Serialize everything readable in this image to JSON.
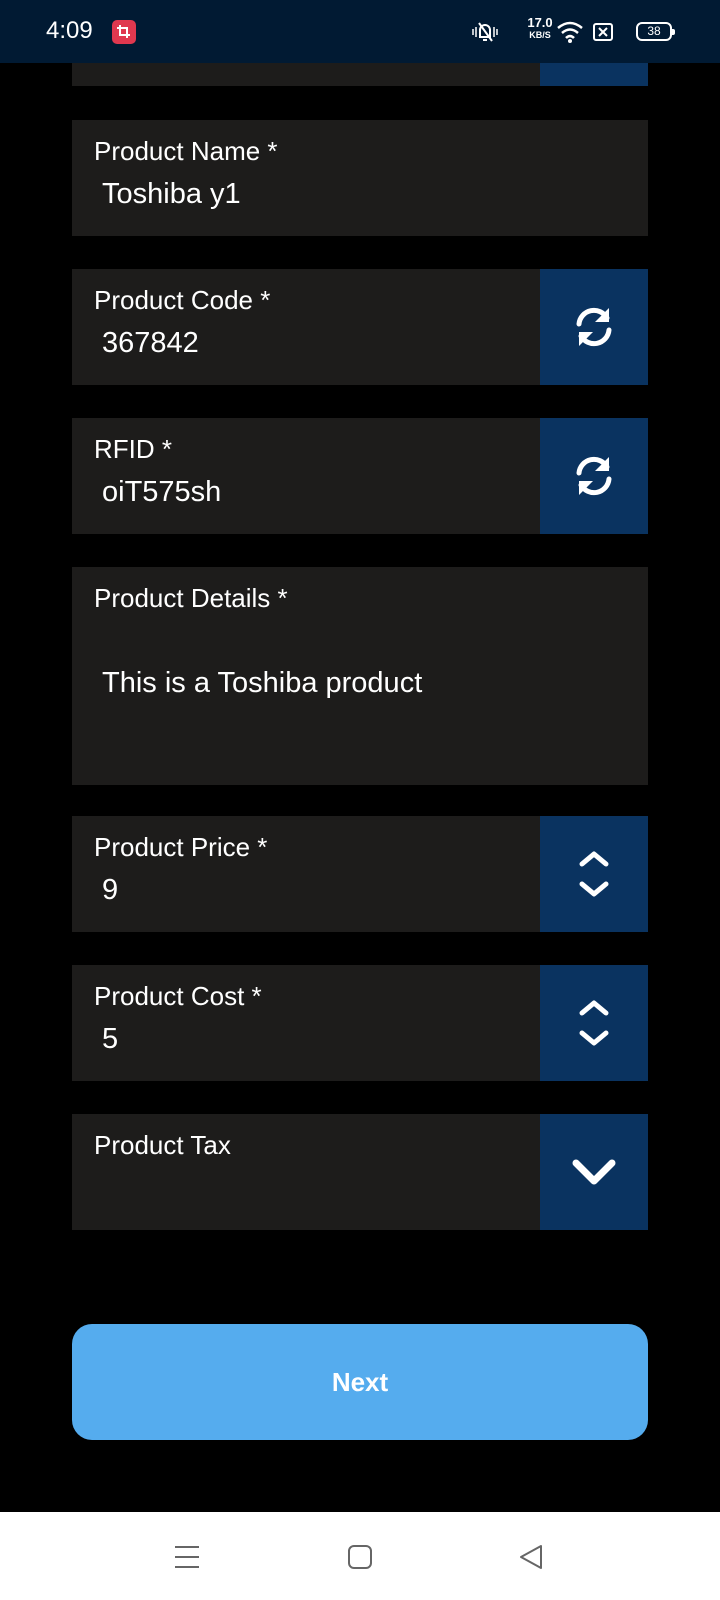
{
  "status_bar": {
    "time": "4:09",
    "network_speed_value": "17.0",
    "network_speed_unit": "KB/S",
    "battery_level": "38",
    "icons": [
      "screen-record-icon",
      "vibrate-icon",
      "wifi-icon",
      "no-sim-icon",
      "battery-icon"
    ]
  },
  "form": {
    "fields": [
      {
        "label": "Product Name *",
        "value": "Toshiba y1"
      },
      {
        "label": "Product Code *",
        "value": "367842",
        "action_icon": "refresh-icon"
      },
      {
        "label": "RFID *",
        "value": "oiT575sh",
        "action_icon": "refresh-icon"
      },
      {
        "label": "Product Details *",
        "value": "This is a Toshiba product"
      },
      {
        "label": "Product Price *",
        "value": "9",
        "action_icon": "stepper-icon"
      },
      {
        "label": "Product Cost *",
        "value": "5",
        "action_icon": "stepper-icon"
      },
      {
        "label": "Product Tax",
        "value": "",
        "action_icon": "chevron-down-icon"
      }
    ],
    "next_label": "Next"
  },
  "colors": {
    "status_bar_bg": "#011a33",
    "field_bg": "#1d1c1b",
    "action_button_bg": "#0a3360",
    "next_button_bg": "#55acee",
    "app_icon_red": "#e0384f"
  },
  "nav_bar": {
    "icons": [
      "menu-icon",
      "home-icon",
      "back-icon"
    ]
  }
}
